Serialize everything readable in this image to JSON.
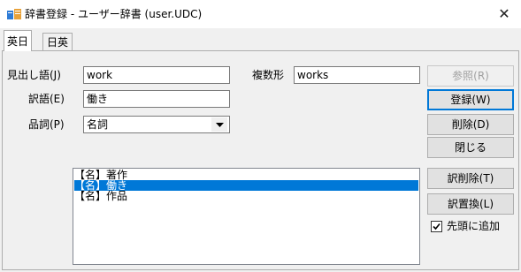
{
  "window": {
    "title": "辞書登録 - ユーザー辞書 (user.UDC)",
    "close_glyph": "✕"
  },
  "tabs": [
    {
      "label": "英日",
      "active": true
    },
    {
      "label": "日英",
      "active": false
    }
  ],
  "form": {
    "headword_label": "見出し語(J)",
    "headword_value": "work",
    "plural_label": "複数形",
    "plural_value": "works",
    "translation_label": "訳語(E)",
    "translation_value": "働き",
    "pos_label": "品詞(P)",
    "pos_value": "名詞"
  },
  "buttons": {
    "browse": "参照(R)",
    "register": "登録(W)",
    "delete": "削除(D)",
    "close": "閉じる",
    "delete_translation": "訳削除(T)",
    "replace_translation": "訳置換(L)"
  },
  "translations_list": [
    {
      "text": "【名】著作",
      "selected": false
    },
    {
      "text": "【名】働き",
      "selected": true
    },
    {
      "text": "【名】作品",
      "selected": false
    }
  ],
  "options": {
    "add_to_top_label": "先頭に追加",
    "add_to_top_checked": true
  }
}
